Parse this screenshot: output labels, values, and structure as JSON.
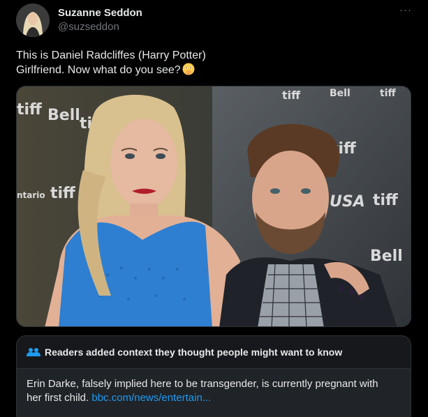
{
  "author": {
    "name": "Suzanne Seddon",
    "handle": "@suzseddon",
    "avatar_icon": "profile-photo"
  },
  "more_icon": "more-horizontal-icon",
  "more_label": "···",
  "tweet": {
    "line1": "This is Daniel Radcliffes (Harry Potter)",
    "line2": "Girlfriend. Now what do you see?",
    "emoji": "face-with-open-eyes-and-hand-over-mouth"
  },
  "media": {
    "type": "photo",
    "backdrop_logos": [
      "tiff",
      "Bell",
      "tiff",
      "Bell",
      "tiff",
      "tiff",
      "tiff",
      "Bell",
      "USA"
    ]
  },
  "community_note": {
    "icon": "people-icon",
    "title": "Readers added context they thought people might want to know",
    "body_line1": "Erin Darke, falsely implied here to be transgender, is currently pregnant with",
    "body_line2": "her first child.",
    "link_text": "bbc.com/news/entertain..."
  },
  "colors": {
    "background": "#000000",
    "text": "#e7e9ea",
    "secondary": "#71767b",
    "link": "#1d9bf0",
    "border": "#2f3336"
  }
}
